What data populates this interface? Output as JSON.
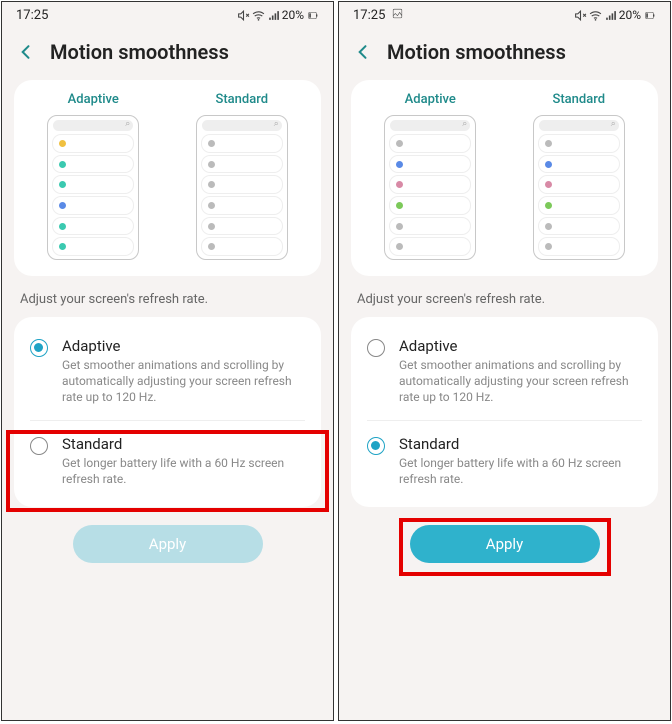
{
  "panes": {
    "left": {
      "status": {
        "time": "17:25",
        "battery": "20%"
      },
      "title": "Motion smoothness",
      "preview": {
        "adaptive": "Adaptive",
        "standard": "Standard"
      },
      "adaptive_dots": [
        "#f0c040",
        "#3bc9b0",
        "#3bc9b0",
        "#5a8ae6",
        "#3bc9b0",
        "#3bc9b0"
      ],
      "standard_dots": [
        "#bbb",
        "#bbb",
        "#bbb",
        "#bbb",
        "#bbb",
        "#bbb"
      ],
      "subtext": "Adjust your screen's refresh rate.",
      "options": {
        "adaptive": {
          "title": "Adaptive",
          "desc": "Get smoother animations and scrolling by automatically adjusting your screen refresh rate up to 120 Hz.",
          "selected": true
        },
        "standard": {
          "title": "Standard",
          "desc": "Get longer battery life with a 60 Hz screen refresh rate.",
          "selected": false
        }
      },
      "apply_label": "Apply",
      "apply_state": "disabled",
      "highlight": "standard-option"
    },
    "right": {
      "status": {
        "time": "17:25",
        "battery": "20%"
      },
      "title": "Motion smoothness",
      "preview": {
        "adaptive": "Adaptive",
        "standard": "Standard"
      },
      "adaptive_dots": [
        "#bbb",
        "#5a8ae6",
        "#d88aa6",
        "#7cc95a",
        "#bbb",
        "#bbb"
      ],
      "standard_dots": [
        "#bbb",
        "#5a8ae6",
        "#d88aa6",
        "#7cc95a",
        "#bbb",
        "#bbb"
      ],
      "subtext": "Adjust your screen's refresh rate.",
      "options": {
        "adaptive": {
          "title": "Adaptive",
          "desc": "Get smoother animations and scrolling by automatically adjusting your screen refresh rate up to 120 Hz.",
          "selected": false
        },
        "standard": {
          "title": "Standard",
          "desc": "Get longer battery life with a 60 Hz screen refresh rate.",
          "selected": true
        }
      },
      "apply_label": "Apply",
      "apply_state": "enabled",
      "highlight": "apply-button"
    }
  }
}
